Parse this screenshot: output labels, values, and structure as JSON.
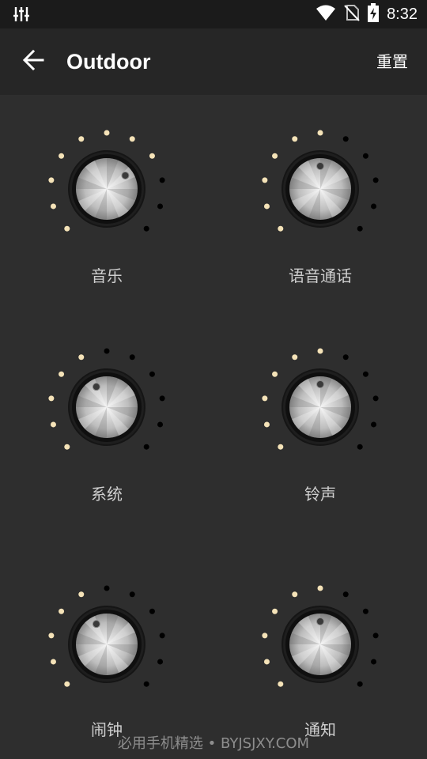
{
  "status_bar": {
    "time": "8:32",
    "icons": [
      "equalizer-icon",
      "wifi-icon",
      "no-sim-icon",
      "battery-charging-icon"
    ]
  },
  "app_bar": {
    "back_icon": "arrow-left-icon",
    "title": "Outdoor",
    "reset_label": "重置"
  },
  "colors": {
    "background": "#2e2e2e",
    "app_bar": "#262626",
    "status_bar": "#1b1b1b",
    "dot_active": "#f5e3b8",
    "dot_inactive": "#000000",
    "label": "#cfcfcf"
  },
  "knobs": [
    {
      "label": "音乐",
      "level": 0.7
    },
    {
      "label": "语音通话",
      "level": 0.5
    },
    {
      "label": "系统",
      "level": 0.4
    },
    {
      "label": "铃声",
      "level": 0.5
    },
    {
      "label": "闹钟",
      "level": 0.4
    },
    {
      "label": "通知",
      "level": 0.5
    }
  ],
  "watermark": "必用手机精选 • BYJSJXY.COM"
}
